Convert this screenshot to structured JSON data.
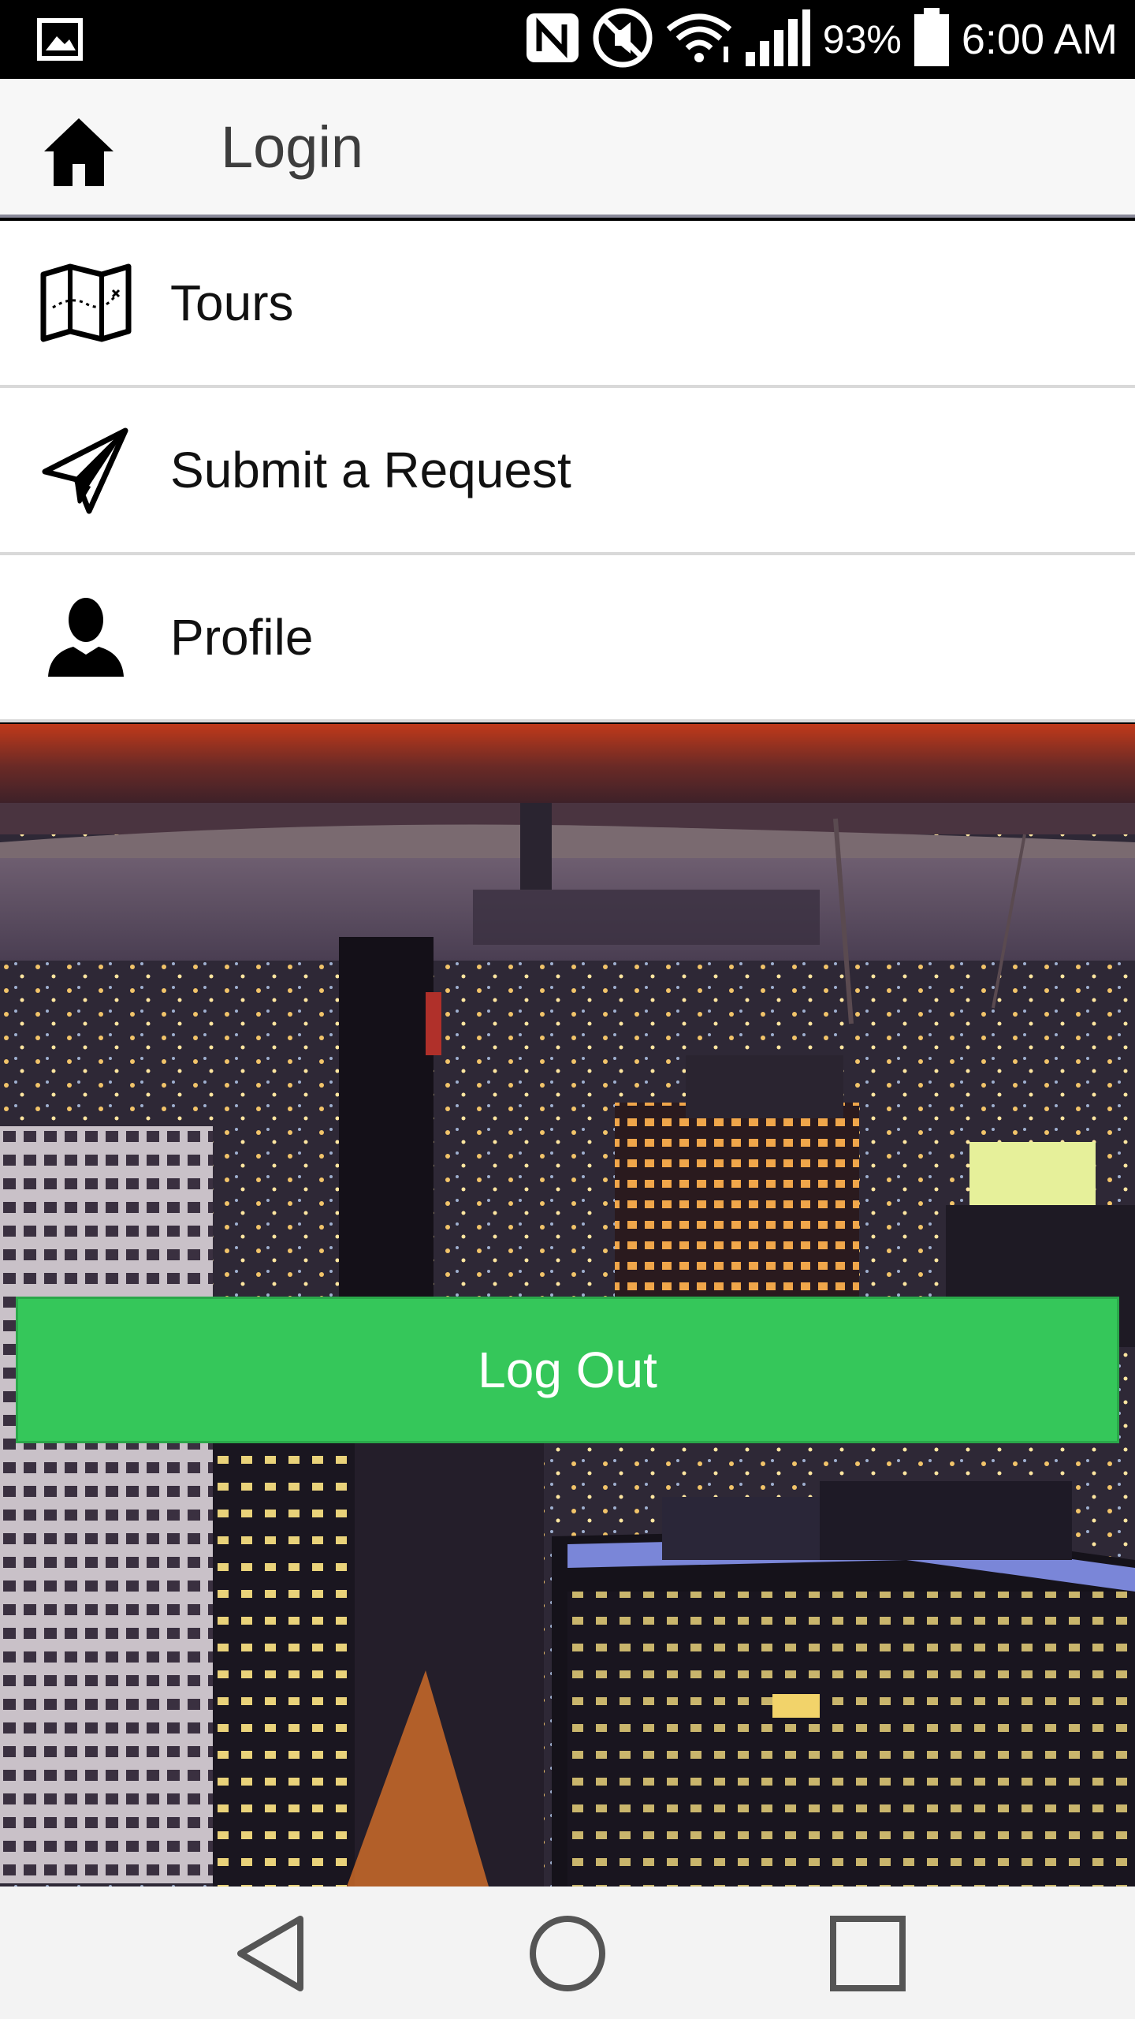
{
  "status_bar": {
    "battery_percent": "93%",
    "time": "6:00 AM",
    "icons": [
      "gallery-icon",
      "nfc-icon",
      "mute-icon",
      "wifi-icon",
      "signal-icon",
      "battery-icon"
    ]
  },
  "header": {
    "title": "Login",
    "home_icon": "home-icon"
  },
  "menu": {
    "items": [
      {
        "label": "Tours",
        "icon": "map-icon"
      },
      {
        "label": "Submit a Request",
        "icon": "paper-plane-icon"
      },
      {
        "label": "Profile",
        "icon": "person-icon"
      }
    ]
  },
  "logout": {
    "label": "Log Out",
    "color": "#35c75a"
  },
  "nav_bar": {
    "icons": [
      "back-icon",
      "home-circle-icon",
      "recents-icon"
    ]
  }
}
